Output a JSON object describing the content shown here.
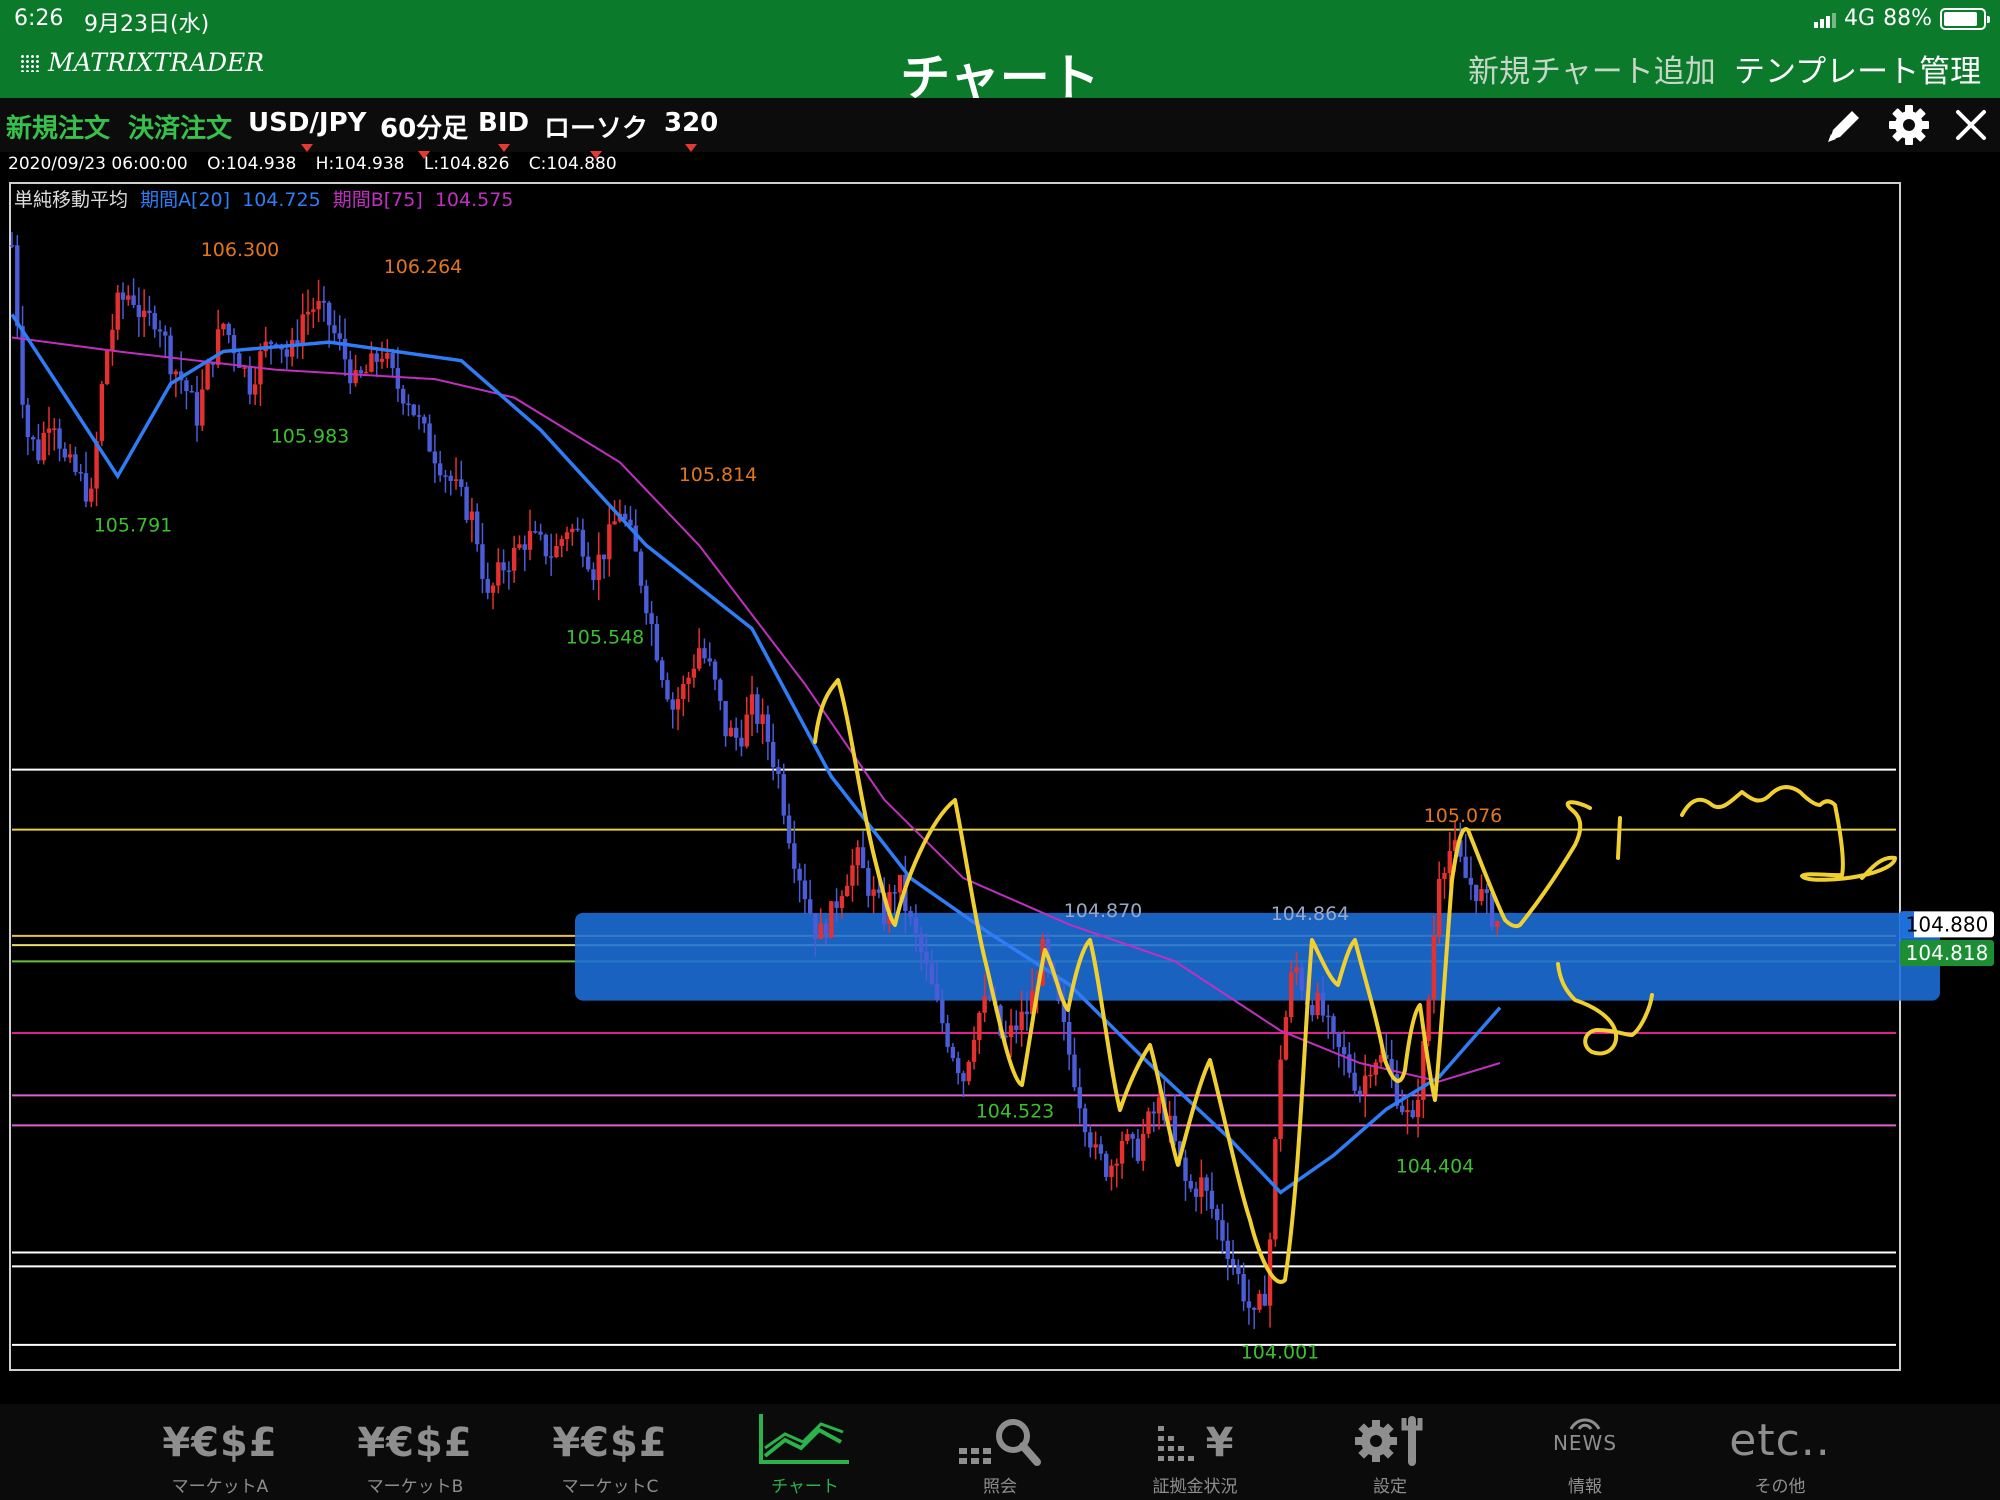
{
  "status_bar": {
    "time": "6:26",
    "date": "9月23日(水)",
    "network": "4G",
    "battery_percent": "88%",
    "battery_level": 0.88
  },
  "app_bar": {
    "logo": "MATRIXTRADER",
    "title": "チャート",
    "add_chart": "新規チャート追加",
    "template_manage": "テンプレート管理"
  },
  "toolbar": {
    "new_order": "新規注文",
    "settle_order": "決済注文",
    "pair": "USD/JPY",
    "timeframe": "60分足",
    "price_type": "BID",
    "chart_style": "ローソク",
    "count": "320",
    "icons": [
      "pencil-icon",
      "gear-icon",
      "close-icon"
    ]
  },
  "ohlc": {
    "datetime": "2020/09/23 06:00:00",
    "open": "O:104.938",
    "high": "H:104.938",
    "low": "L:104.826",
    "close": "C:104.880"
  },
  "indicator": {
    "name": "単純移動平均",
    "period_a": "期間A[20]",
    "value_a": "104.725",
    "period_b": "期間B[75]",
    "value_b": "104.575",
    "color_a": "#2f7df6",
    "color_b": "#c030c0"
  },
  "chart_data": {
    "type": "candlestick",
    "title": "",
    "ylim": [
      103.92,
      106.48
    ],
    "price_labels": {
      "current": "104.880",
      "secondary": "104.818"
    },
    "annotations": [
      {
        "text": "106.300",
        "value": 106.3,
        "kind": "high"
      },
      {
        "text": "106.264",
        "value": 106.264,
        "kind": "high"
      },
      {
        "text": "105.983",
        "value": 105.983,
        "kind": "low"
      },
      {
        "text": "105.791",
        "value": 105.791,
        "kind": "low"
      },
      {
        "text": "105.814",
        "value": 105.814,
        "kind": "high"
      },
      {
        "text": "105.548",
        "value": 105.548,
        "kind": "low"
      },
      {
        "text": "104.870",
        "value": 104.87,
        "kind": "high"
      },
      {
        "text": "104.864",
        "value": 104.864,
        "kind": "high"
      },
      {
        "text": "105.076",
        "value": 105.076,
        "kind": "high"
      },
      {
        "text": "104.523",
        "value": 104.523,
        "kind": "low"
      },
      {
        "text": "104.404",
        "value": 104.404,
        "kind": "low"
      },
      {
        "text": "104.001",
        "value": 104.001,
        "kind": "low"
      }
    ],
    "horizontal_lines": [
      {
        "price": 105.215,
        "color": "#ffffff"
      },
      {
        "price": 105.085,
        "color": "#e6d23a"
      },
      {
        "price": 104.855,
        "color": "#e6c23a"
      },
      {
        "price": 104.835,
        "color": "#e6e06a"
      },
      {
        "price": 104.8,
        "color": "#6bbf3a"
      },
      {
        "price": 104.645,
        "color": "#e0208a"
      },
      {
        "price": 104.51,
        "color": "#e060d0"
      },
      {
        "price": 104.445,
        "color": "#e060d0"
      },
      {
        "price": 104.17,
        "color": "#ffffff"
      },
      {
        "price": 104.14,
        "color": "#ffffff"
      },
      {
        "price": 103.97,
        "color": "#ffffff"
      }
    ],
    "highlight_band": {
      "from": 104.715,
      "to": 104.905,
      "color": "#1e6fd9"
    },
    "price_path": [
      [
        0,
        106.35
      ],
      [
        5,
        105.95
      ],
      [
        10,
        105.9
      ],
      [
        15,
        106.0
      ],
      [
        20,
        105.88
      ],
      [
        25,
        105.85
      ],
      [
        30,
        105.8
      ],
      [
        35,
        106.1
      ],
      [
        40,
        106.22
      ],
      [
        45,
        106.25
      ],
      [
        50,
        106.18
      ],
      [
        55,
        106.2
      ],
      [
        60,
        106.1
      ],
      [
        65,
        106.05
      ],
      [
        70,
        105.98
      ],
      [
        75,
        106.1
      ],
      [
        80,
        106.18
      ],
      [
        85,
        106.12
      ],
      [
        90,
        106.05
      ],
      [
        95,
        106.12
      ],
      [
        100,
        106.16
      ],
      [
        105,
        106.1
      ],
      [
        110,
        106.2
      ],
      [
        115,
        106.22
      ],
      [
        120,
        106.18
      ],
      [
        125,
        106.12
      ],
      [
        130,
        106.05
      ],
      [
        135,
        106.08
      ],
      [
        140,
        106.12
      ],
      [
        145,
        106.05
      ],
      [
        150,
        106.02
      ],
      [
        155,
        105.95
      ],
      [
        160,
        105.9
      ],
      [
        165,
        105.85
      ],
      [
        170,
        105.8
      ],
      [
        175,
        105.75
      ],
      [
        180,
        105.58
      ],
      [
        185,
        105.65
      ],
      [
        190,
        105.68
      ],
      [
        195,
        105.72
      ],
      [
        200,
        105.7
      ],
      [
        205,
        105.68
      ],
      [
        210,
        105.74
      ],
      [
        215,
        105.72
      ],
      [
        220,
        105.65
      ],
      [
        225,
        105.7
      ],
      [
        230,
        105.78
      ],
      [
        235,
        105.7
      ],
      [
        240,
        105.58
      ],
      [
        245,
        105.45
      ],
      [
        250,
        105.35
      ],
      [
        255,
        105.4
      ],
      [
        260,
        105.48
      ],
      [
        265,
        105.42
      ],
      [
        270,
        105.3
      ],
      [
        275,
        105.28
      ],
      [
        280,
        105.35
      ],
      [
        285,
        105.3
      ],
      [
        290,
        105.2
      ],
      [
        295,
        105.05
      ],
      [
        300,
        104.95
      ],
      [
        305,
        104.85
      ],
      [
        310,
        104.9
      ],
      [
        315,
        104.98
      ],
      [
        320,
        105.02
      ],
      [
        325,
        104.95
      ],
      [
        330,
        104.9
      ],
      [
        335,
        104.98
      ],
      [
        340,
        104.88
      ],
      [
        345,
        104.8
      ],
      [
        350,
        104.7
      ],
      [
        355,
        104.62
      ],
      [
        360,
        104.55
      ],
      [
        365,
        104.68
      ],
      [
        370,
        104.72
      ],
      [
        375,
        104.62
      ],
      [
        380,
        104.66
      ],
      [
        385,
        104.7
      ],
      [
        390,
        104.82
      ],
      [
        395,
        104.72
      ],
      [
        400,
        104.6
      ],
      [
        405,
        104.48
      ],
      [
        410,
        104.38
      ],
      [
        415,
        104.35
      ],
      [
        420,
        104.42
      ],
      [
        425,
        104.38
      ],
      [
        430,
        104.45
      ],
      [
        435,
        104.5
      ],
      [
        440,
        104.4
      ],
      [
        445,
        104.3
      ],
      [
        450,
        104.32
      ],
      [
        455,
        104.25
      ],
      [
        460,
        104.18
      ],
      [
        465,
        104.1
      ],
      [
        470,
        104.02
      ],
      [
        475,
        104.1
      ],
      [
        480,
        104.6
      ],
      [
        485,
        104.8
      ],
      [
        490,
        104.72
      ],
      [
        495,
        104.7
      ],
      [
        500,
        104.62
      ],
      [
        505,
        104.58
      ],
      [
        510,
        104.52
      ],
      [
        515,
        104.6
      ],
      [
        520,
        104.58
      ],
      [
        525,
        104.5
      ],
      [
        530,
        104.44
      ],
      [
        535,
        104.65
      ],
      [
        540,
        105.0
      ],
      [
        545,
        105.05
      ],
      [
        550,
        104.98
      ],
      [
        555,
        104.95
      ],
      [
        560,
        104.9
      ],
      [
        563,
        104.88
      ]
    ],
    "sma_a": [
      [
        0,
        106.2
      ],
      [
        40,
        105.85
      ],
      [
        60,
        106.05
      ],
      [
        80,
        106.12
      ],
      [
        120,
        106.14
      ],
      [
        170,
        106.1
      ],
      [
        200,
        105.95
      ],
      [
        240,
        105.7
      ],
      [
        280,
        105.52
      ],
      [
        310,
        105.2
      ],
      [
        340,
        104.98
      ],
      [
        370,
        104.86
      ],
      [
        400,
        104.75
      ],
      [
        430,
        104.58
      ],
      [
        460,
        104.42
      ],
      [
        480,
        104.3
      ],
      [
        500,
        104.38
      ],
      [
        520,
        104.48
      ],
      [
        540,
        104.55
      ],
      [
        563,
        104.7
      ]
    ],
    "sma_b": [
      [
        0,
        106.15
      ],
      [
        40,
        106.12
      ],
      [
        100,
        106.08
      ],
      [
        160,
        106.06
      ],
      [
        190,
        106.02
      ],
      [
        230,
        105.88
      ],
      [
        260,
        105.7
      ],
      [
        300,
        105.4
      ],
      [
        330,
        105.15
      ],
      [
        360,
        104.98
      ],
      [
        400,
        104.88
      ],
      [
        440,
        104.8
      ],
      [
        480,
        104.65
      ],
      [
        510,
        104.58
      ],
      [
        540,
        104.54
      ],
      [
        563,
        104.58
      ]
    ]
  },
  "drawings": {
    "color": "#f0d030"
  },
  "tab_bar": {
    "tabs": [
      {
        "icon_text": "¥€$£",
        "label": "マーケットA",
        "icon": "currency-icon"
      },
      {
        "icon_text": "¥€$£",
        "label": "マーケットB",
        "icon": "currency-icon"
      },
      {
        "icon_text": "¥€$£",
        "label": "マーケットC",
        "icon": "currency-icon"
      },
      {
        "icon_text": "",
        "label": "チャート",
        "icon": "chart-icon"
      },
      {
        "icon_text": "",
        "label": "照会",
        "icon": "search-icon"
      },
      {
        "icon_text": "¥",
        "label": "証拠金状況",
        "icon": "margin-icon"
      },
      {
        "icon_text": "",
        "label": "設定",
        "icon": "settings-icon"
      },
      {
        "icon_text": "NEWS",
        "label": "情報",
        "icon": "news-icon"
      },
      {
        "icon_text": "etc..",
        "label": "その他",
        "icon": "more-icon"
      }
    ],
    "active": "チャート",
    "active_color": "#29b34a"
  }
}
